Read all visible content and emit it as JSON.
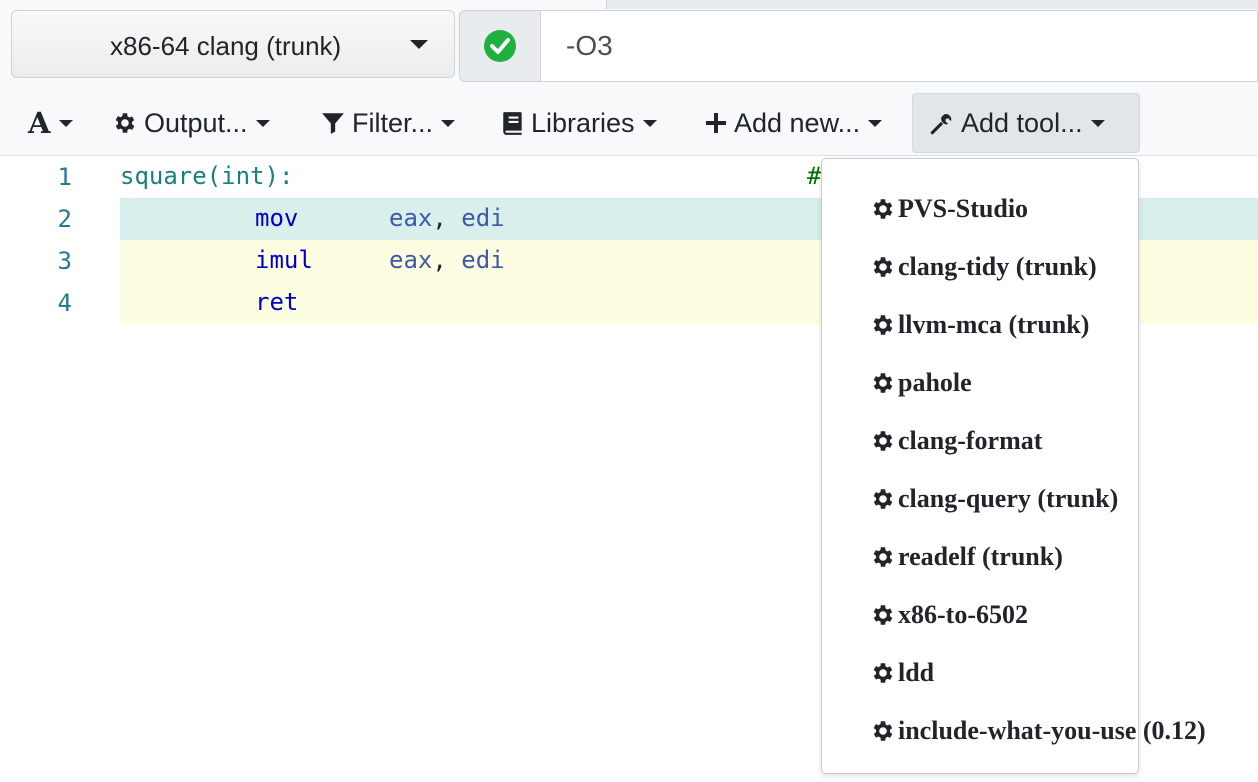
{
  "compiler": {
    "name": "x86-64 clang (trunk)",
    "status": "success",
    "options_value": "-O3"
  },
  "toolbar": {
    "font_button": "A",
    "output_label": "Output...",
    "filter_label": "Filter...",
    "libraries_label": "Libraries",
    "add_new_label": "Add new...",
    "add_tool_label": "Add tool..."
  },
  "editor": {
    "lines": [
      {
        "num": "1",
        "label": "square(int):",
        "op": "",
        "args1": "",
        "sep": "",
        "args2": "",
        "comment": "#"
      },
      {
        "num": "2",
        "label": "",
        "op": "mov",
        "args1": "eax",
        "sep": ", ",
        "args2": "edi",
        "comment": ""
      },
      {
        "num": "3",
        "label": "",
        "op": "imul",
        "args1": "eax",
        "sep": ", ",
        "args2": "edi",
        "comment": ""
      },
      {
        "num": "4",
        "label": "",
        "op": "ret",
        "args1": "",
        "sep": "",
        "args2": "",
        "comment": ""
      }
    ]
  },
  "tools_menu": {
    "items": [
      "PVS-Studio",
      "clang-tidy (trunk)",
      "llvm-mca (trunk)",
      "pahole",
      "clang-format",
      "clang-query (trunk)",
      "readelf (trunk)",
      "x86-to-6502",
      "ldd",
      "include-what-you-use (0.12)"
    ]
  },
  "colors": {
    "success_green": "#20b03e",
    "line2_highlight": "#d8efec",
    "line3_4_highlight": "#fdfde1",
    "line_number": "#237893"
  }
}
